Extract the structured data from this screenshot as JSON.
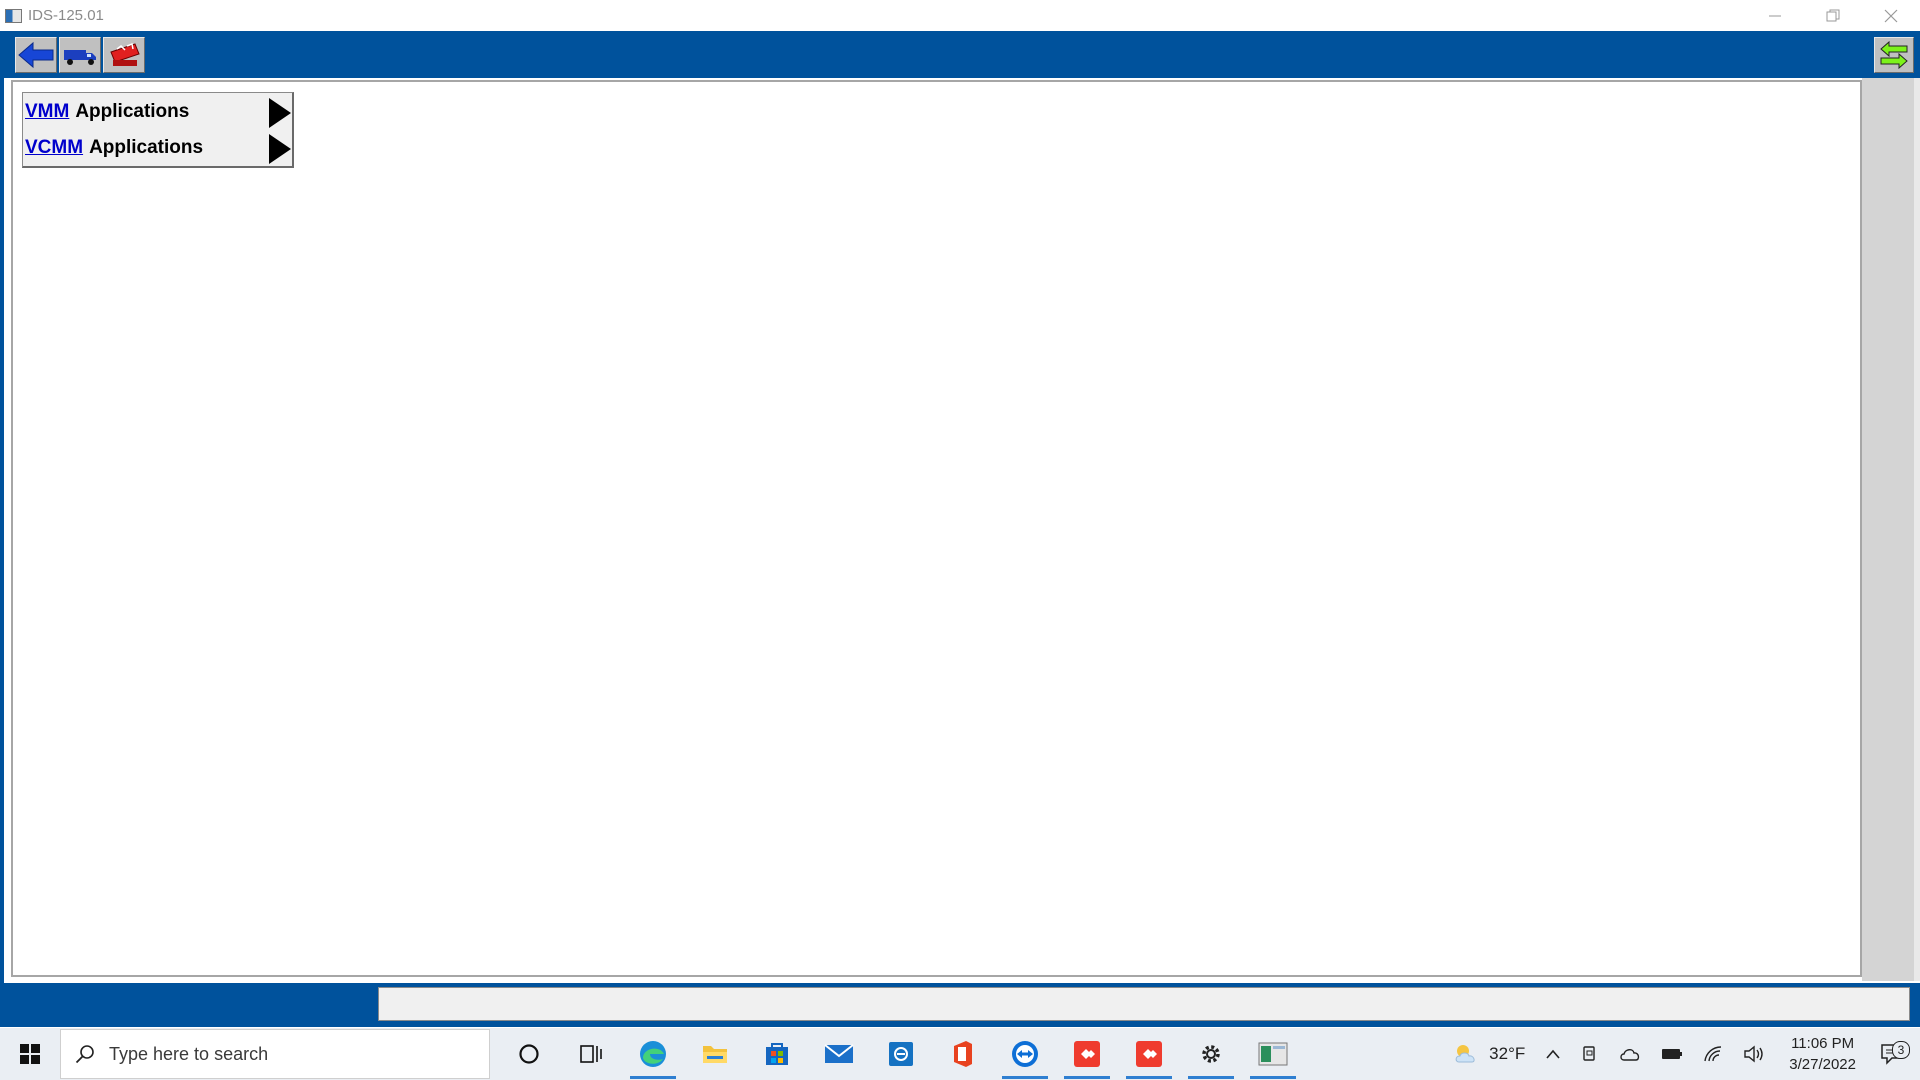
{
  "window": {
    "title": "IDS-125.01",
    "controls": [
      "minimize-icon",
      "restore-icon",
      "close-icon"
    ]
  },
  "toolbar": {
    "buttons": [
      {
        "name": "back-button",
        "icon": "blue-left-arrow-icon"
      },
      {
        "name": "vehicle-button",
        "icon": "blue-truck-icon"
      },
      {
        "name": "toolbox-button",
        "icon": "red-toolbox-icon"
      }
    ],
    "right_button": {
      "name": "switch-button",
      "icon": "green-double-arrow-icon"
    }
  },
  "menu": {
    "items": [
      {
        "key": "VMM",
        "label": "Applications"
      },
      {
        "key": "VCMM",
        "label": "Applications"
      }
    ]
  },
  "taskbar": {
    "search_placeholder": "Type here to search",
    "weather": "32°F",
    "time": "11:06 PM",
    "date": "3/27/2022",
    "notification_count": "3",
    "colors": {
      "accent": "#00529c",
      "taskbar": "#eaeef3"
    }
  }
}
